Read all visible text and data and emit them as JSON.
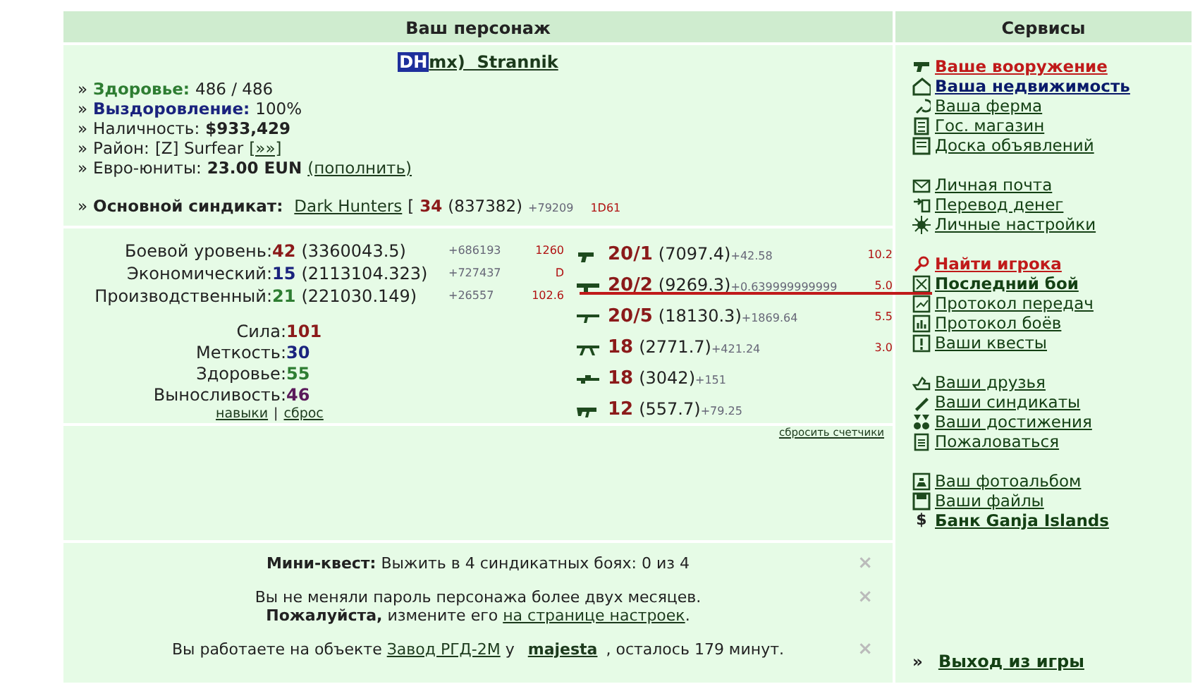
{
  "headers": {
    "character": "Ваш персонаж",
    "services": "Сервисы"
  },
  "character": {
    "clan_tag": "DH",
    "name": "mx)  Strannik"
  },
  "info": [
    {
      "kind": "health",
      "marker": "»",
      "label": "Здоровье:",
      "value": "486 / 486"
    },
    {
      "kind": "recovery",
      "marker": "»",
      "label": "Выздоровление:",
      "value": "100%"
    },
    {
      "kind": "money",
      "marker": "»",
      "label": "Наличность:",
      "value": "$933,429"
    },
    {
      "kind": "district",
      "marker": "»",
      "label": "Район:",
      "value": "[Z] Surfear",
      "link": "[»»]"
    },
    {
      "kind": "euro",
      "marker": "»",
      "label": "Евро-юниты:",
      "value": "23.00 EUN",
      "link": "(пополнить)"
    }
  ],
  "syndicate": {
    "marker": "»",
    "label": "Основной синдикат:",
    "name": "Dark Hunters",
    "bracket": "[",
    "rank": "34",
    "exp": "(837382)",
    "gain": "+79209",
    "extra": "1D61"
  },
  "skills": [
    {
      "label": "Боевой уровень:",
      "value": "42",
      "exp": "(3360043.5)",
      "gain": "+686193",
      "extra": "1260",
      "color": "#8b1a1a"
    },
    {
      "label": "Экономический:",
      "value": "15",
      "exp": "(2113104.323)",
      "gain": "+727437",
      "extra": "D",
      "color": "#1a237e"
    },
    {
      "label": "Производственный:",
      "value": "21",
      "exp": "(221030.149)",
      "gain": "+26557",
      "extra": "102.6",
      "color": "#2e7d32"
    }
  ],
  "attributes": [
    {
      "label": "Сила:",
      "value": "101",
      "color": "#8b1a1a"
    },
    {
      "label": "Меткость:",
      "value": "30",
      "color": "#1a237e"
    },
    {
      "label": "Здоровье:",
      "value": "55",
      "color": "#2e7d32"
    },
    {
      "label": "Выносливость:",
      "value": "46",
      "color": "#5a1a5a"
    }
  ],
  "skill_links": {
    "first": "навыки",
    "separator": "|",
    "second": "сброс"
  },
  "weapons": [
    {
      "kind": "pistol",
      "value": "20/1",
      "exp": "(7097.4)",
      "gain": "+42.58",
      "extra": "10.2"
    },
    {
      "kind": "launcher",
      "value": "20/2",
      "exp": "(9269.3)",
      "gain": "+0.639999999999",
      "extra": "5.0"
    },
    {
      "kind": "rifle",
      "value": "20/5",
      "exp": "(18130.3)",
      "gain": "+1869.64",
      "extra": "5.5"
    },
    {
      "kind": "heavy",
      "value": "18",
      "exp": "(2771.7)",
      "gain": "+421.24",
      "extra": "3.0"
    },
    {
      "kind": "sniper",
      "value": "18",
      "exp": "(3042)",
      "gain": "+151"
    },
    {
      "kind": "smg",
      "value": "12",
      "exp": "(557.7)",
      "gain": "+79.25"
    }
  ],
  "reset_link": "сбросить счетчики",
  "services": [
    [
      {
        "label": "Ваше вооружение",
        "kind": "alert"
      },
      {
        "label": "Ваша недвижимость",
        "kind": "primary"
      },
      {
        "label": "Ваша ферма",
        "kind": "plain"
      },
      {
        "label": "Гос. магазин",
        "kind": "plain"
      },
      {
        "label": "Доска объявлений",
        "kind": "plain"
      }
    ],
    [
      {
        "label": "Личная почта",
        "kind": "plain"
      },
      {
        "label": "Перевод денег",
        "kind": "plain"
      },
      {
        "label": "Личные настройки",
        "kind": "plain"
      }
    ],
    [
      {
        "label": "Найти игрока",
        "kind": "alert"
      },
      {
        "label": "Последний бой",
        "kind": "strong"
      },
      {
        "label": "Протокол передач",
        "kind": "plain"
      },
      {
        "label": "Протокол боёв",
        "kind": "plain"
      },
      {
        "label": "Ваши квесты",
        "kind": "plain"
      }
    ],
    [
      {
        "label": "Ваши друзья",
        "kind": "plain"
      },
      {
        "label": "Ваши синдикаты",
        "kind": "plain"
      },
      {
        "label": "Ваши достижения",
        "kind": "plain"
      },
      {
        "label": "Пожаловаться",
        "kind": "plain"
      }
    ],
    [
      {
        "label": "Ваш фотоальбом",
        "kind": "plain"
      },
      {
        "label": "Ваши файлы",
        "kind": "plain"
      },
      {
        "glyph": "$",
        "label": "Банк Ganja Islands",
        "kind": "strong"
      }
    ]
  ],
  "exit": {
    "marker": "»",
    "label": "Выход из игры"
  },
  "notices": [
    {
      "close": "×",
      "lines": [
        [
          {
            "kind": "text",
            "text": "**Мини-квест:** Выжить в 4 синдикатных боях: 0 из 4"
          }
        ]
      ]
    },
    {
      "close": "×",
      "lines": [
        [
          {
            "kind": "text",
            "text": "Вы не меняли пароль персонажа более двух месяцев."
          }
        ],
        [
          {
            "kind": "text",
            "text": "**Пожалуйста,** измените его "
          },
          {
            "kind": "link",
            "text": "на странице настроек"
          },
          {
            "kind": "text",
            "text": "."
          }
        ]
      ]
    },
    {
      "close": "×",
      "lines": [
        [
          {
            "kind": "text",
            "text": "Вы работаете на объекте "
          },
          {
            "kind": "link",
            "text": "Завод РГД-2М"
          },
          {
            "kind": "text",
            "text": " у "
          },
          {
            "kind": "strong_link",
            "text": "majesta"
          },
          {
            "kind": "text",
            "text": ", осталось 179 минут."
          }
        ]
      ]
    }
  ]
}
